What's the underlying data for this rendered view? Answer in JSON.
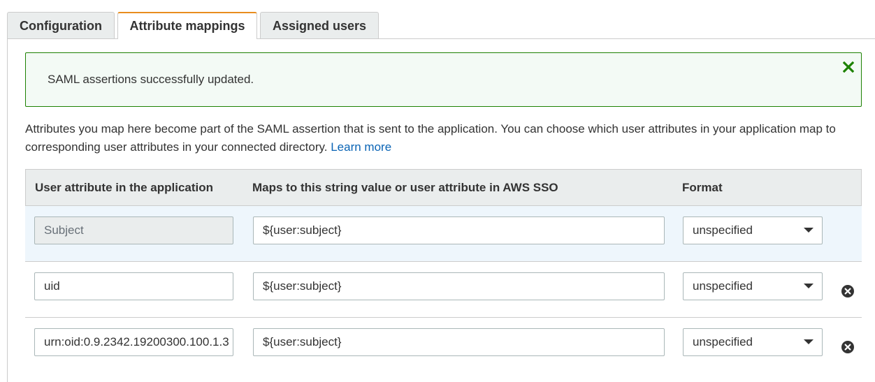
{
  "tabs": [
    {
      "label": "Configuration"
    },
    {
      "label": "Attribute mappings",
      "active": true
    },
    {
      "label": "Assigned users"
    }
  ],
  "alert": {
    "message": "SAML assertions successfully updated.",
    "close_icon": "close-x-icon",
    "color": "#1d8102"
  },
  "description": {
    "text": "Attributes you map here become part of the SAML assertion that is sent to the application. You can choose which user attributes in your application map to corresponding user attributes in your connected directory.",
    "link": "Learn more"
  },
  "table": {
    "headers": {
      "app_attribute": "User attribute in the application",
      "maps_to": "Maps to this string value or user attribute in AWS SSO",
      "format": "Format"
    },
    "rows": [
      {
        "attribute": "Subject",
        "value": "${user:subject}",
        "format": "unspecified",
        "removable": false
      },
      {
        "attribute": "uid",
        "value": "${user:subject}",
        "format": "unspecified",
        "removable": true
      },
      {
        "attribute": "urn:oid:0.9.2342.19200300.100.1.3",
        "value": "${user:subject}",
        "format": "unspecified",
        "removable": true
      }
    ]
  },
  "colors": {
    "active_tab_accent": "#e88d1e",
    "link": "#0a64b5",
    "success": "#1d8102"
  }
}
